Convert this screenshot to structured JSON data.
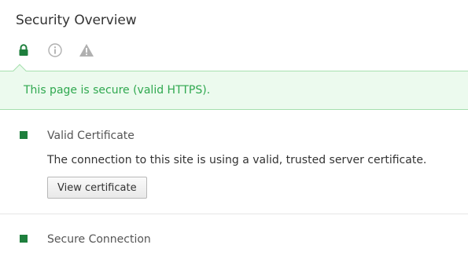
{
  "header": {
    "title": "Security Overview"
  },
  "tabs": [
    {
      "icon": "lock-icon",
      "color": "#1e7f3d",
      "active": true
    },
    {
      "icon": "info-icon",
      "color": "#b0b0b0",
      "active": false
    },
    {
      "icon": "warning-icon",
      "color": "#b0b0b0",
      "active": false
    }
  ],
  "banner": {
    "text": "This page is secure (valid HTTPS).",
    "color": "#2fa84f",
    "background": "#ecfaee"
  },
  "sections": [
    {
      "title": "Valid Certificate",
      "description": "The connection to this site is using a valid, trusted server certificate.",
      "button_label": "View certificate",
      "status_color": "#1e7f3d"
    },
    {
      "title": "Secure Connection",
      "status_color": "#1e7f3d"
    }
  ]
}
